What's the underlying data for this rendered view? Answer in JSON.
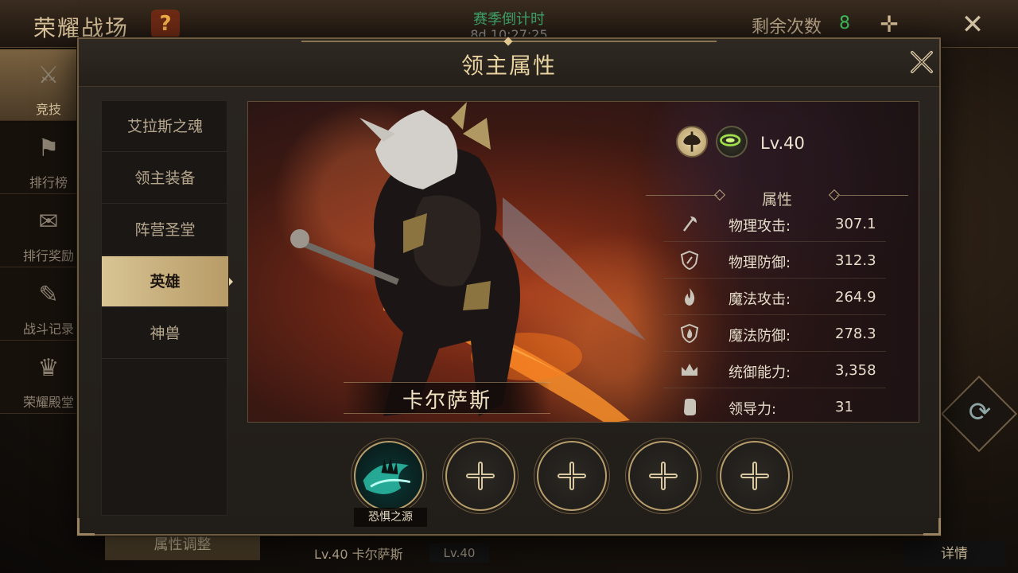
{
  "background": {
    "title": "荣耀战场",
    "help_symbol": "?",
    "season_label": "赛季倒计时",
    "season_countdown": "8d 10:27:25",
    "remaining_label": "剩余次数",
    "remaining_count": "8",
    "plus_symbol": "✛",
    "close_symbol": "✕",
    "sidebar": [
      {
        "label": "竞技",
        "icon": "crossed-swords-icon",
        "glyph": "⚔"
      },
      {
        "label": "排行榜",
        "icon": "banner-icon",
        "glyph": "⚑"
      },
      {
        "label": "排行奖励",
        "icon": "reward-icon",
        "glyph": "✉"
      },
      {
        "label": "战斗记录",
        "icon": "battle-log-icon",
        "glyph": "✎"
      },
      {
        "label": "荣耀殿堂",
        "icon": "hall-of-honor-icon",
        "glyph": "♛"
      }
    ],
    "bottom": {
      "adjust_button": "属性调整",
      "hero_line": "Lv.40 卡尔萨斯",
      "lv_badge": "Lv.40",
      "detail_button": "详情",
      "refresh_glyph": "⟳"
    }
  },
  "modal": {
    "title": "领主属性",
    "tabs": [
      {
        "label": "艾拉斯之魂",
        "active": false
      },
      {
        "label": "领主装备",
        "active": false
      },
      {
        "label": "阵营圣堂",
        "active": false
      },
      {
        "label": "英雄",
        "active": true
      },
      {
        "label": "神兽",
        "active": false
      }
    ],
    "hero": {
      "name": "卡尔萨斯",
      "level": "Lv.40",
      "class_icon": "axe-class-icon"
    },
    "attributes_header": "属性",
    "stats": [
      {
        "label": "物理攻击:",
        "value": "307.1",
        "icon": "axe-icon"
      },
      {
        "label": "物理防御:",
        "value": "312.3",
        "icon": "shield-axe-icon"
      },
      {
        "label": "魔法攻击:",
        "value": "264.9",
        "icon": "flame-icon"
      },
      {
        "label": "魔法防御:",
        "value": "278.3",
        "icon": "shield-flame-icon"
      },
      {
        "label": "统御能力:",
        "value": "3,358",
        "icon": "crown-icon"
      },
      {
        "label": "领导力:",
        "value": "31",
        "icon": "fist-icon"
      }
    ],
    "skill_slots": [
      {
        "filled": true,
        "label": "恐惧之源"
      },
      {
        "filled": false
      },
      {
        "filled": false
      },
      {
        "filled": false
      },
      {
        "filled": false
      }
    ]
  },
  "colors": {
    "gold_text": "#e8d2a0",
    "active_tab": "#d8c494",
    "green_count": "#3fc15c"
  }
}
